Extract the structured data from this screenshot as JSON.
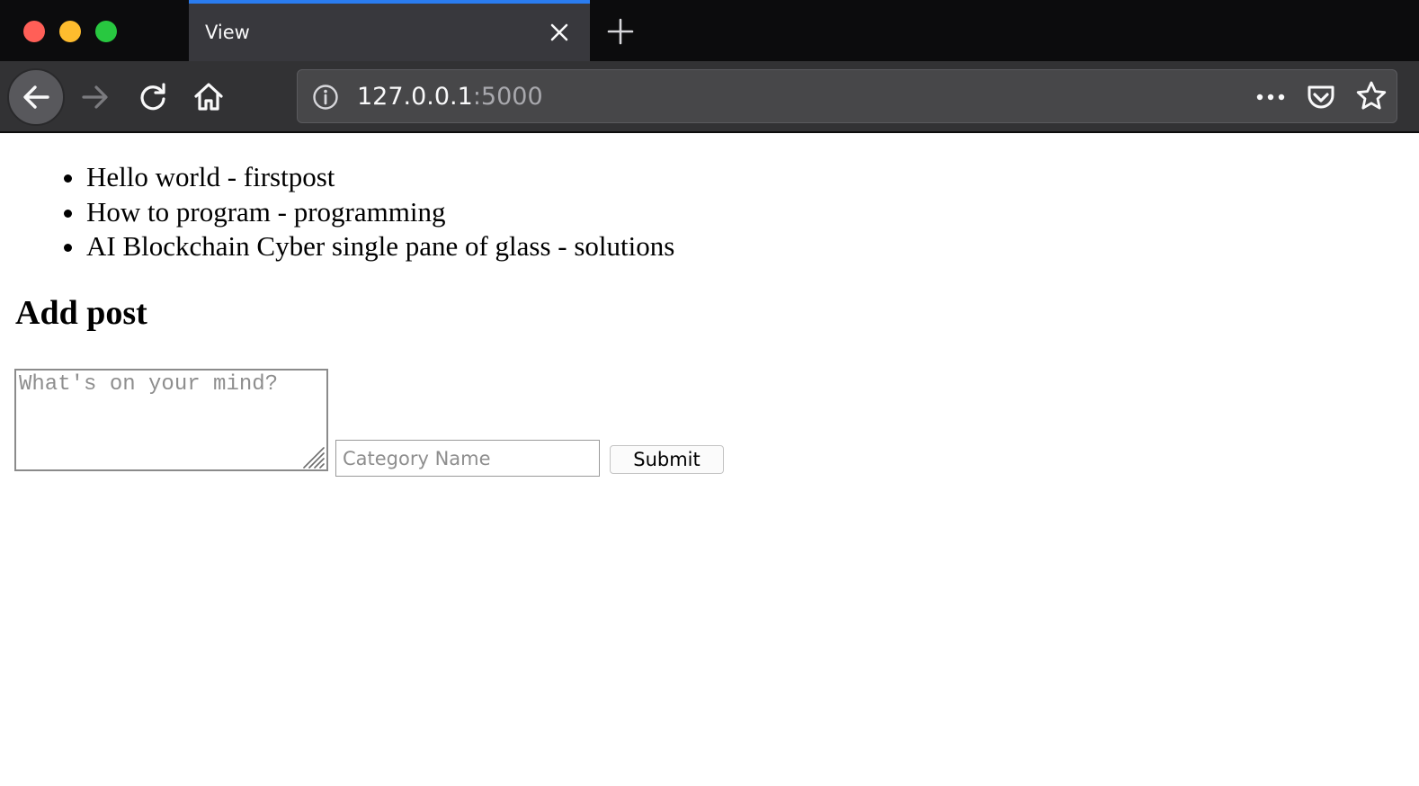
{
  "browser": {
    "tab": {
      "title": "View"
    },
    "url": {
      "host": "127.0.0.1",
      "port": ":5000"
    },
    "icons": {
      "close_tab": "close-icon",
      "new_tab": "plus-icon",
      "back": "arrow-left-icon",
      "forward": "arrow-right-icon",
      "reload": "reload-icon",
      "home": "home-icon",
      "info": "info-icon",
      "more": "more-horizontal-icon",
      "pocket": "pocket-icon",
      "bookmark": "star-icon"
    },
    "colors": {
      "tabbar": "#0c0c0d",
      "active_tab": "#38383d",
      "active_tab_accent": "#2a7cf0",
      "toolbar": "#323234",
      "urlbar": "#474749",
      "close": "#ff5f57",
      "minimize": "#febc2e",
      "maximize": "#28c840"
    }
  },
  "posts": [
    {
      "text": "Hello world - firstpost"
    },
    {
      "text": "How to program - programming"
    },
    {
      "text": "AI Blockchain Cyber single pane of glass - solutions"
    }
  ],
  "form": {
    "heading": "Add post",
    "message_placeholder": "What's on your mind?",
    "category_placeholder": "Category Name",
    "submit_label": "Submit"
  }
}
